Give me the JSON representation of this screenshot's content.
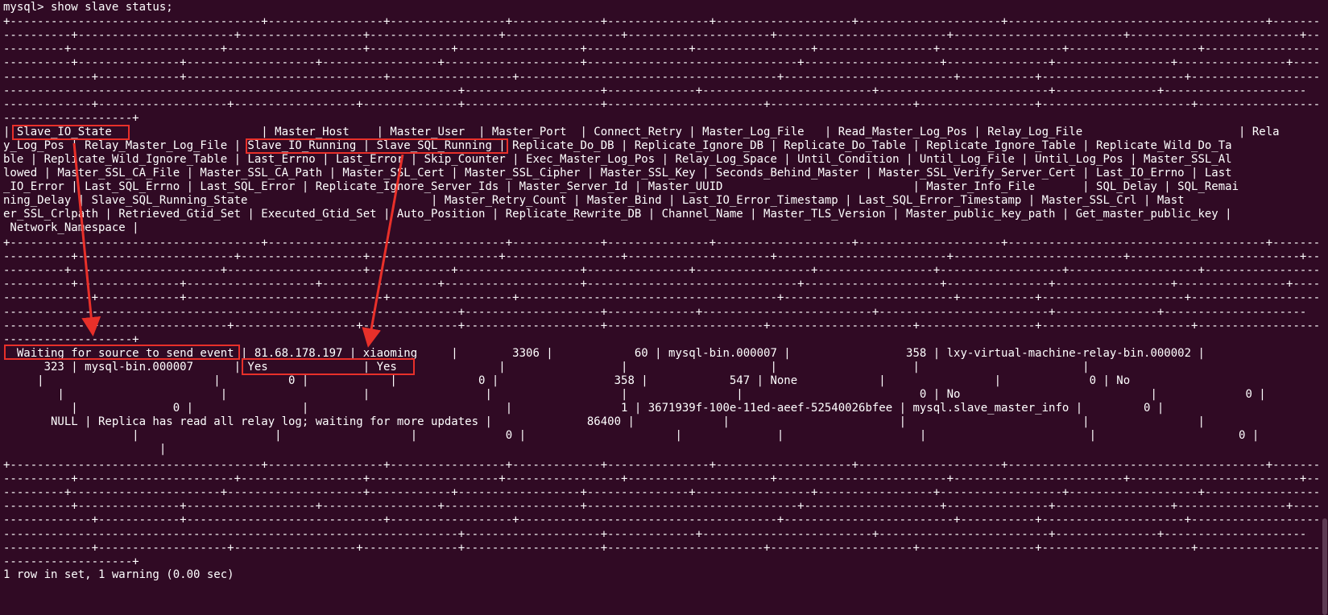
{
  "terminal": {
    "colors": {
      "background": "#300a24",
      "text": "#ffffff",
      "annotation": "#e8302a"
    },
    "lines": [
      "mysql> show slave status;",
      "+-------------------------------------+-----------------+-----------------+-------------+---------------+--------------------+---------------------+--------------------------------------+---------",
      "----------+-----------------------+------------------+-------------------+-----------------+---------------------+-------------------------+-------------------------+-------------------------+---------",
      "---------+----------------------+--------------------+------------+------------------+---------------+-----------------+-----------------+------------------+-------------------+-----------------------",
      "----------+---------------+-------------------+-----------------+--------------------+-------------------------------+--------------------+---------------+-----------------+----------------+---------",
      "-------------+------------+-----------------------------+------------------+--------------------------------------+-------------------------+-----------+---------------------+----------------------",
      "-------------------------------------------------------------------+--------------------+-------------+-------------------------+-------------------------+---------------+---------------------",
      "-------------+-------------------+------------------+--------------+--------------------+-----------------------+---------------------+-----------------+----------------------+-----------------------",
      "-------------------+",
      "| Slave_IO_State                      | Master_Host    | Master_User  | Master_Port  | Connect_Retry | Master_Log_File   | Read_Master_Log_Pos | Relay_Log_File                       | Rela",
      "y_Log_Pos | Relay_Master_Log_File | Slave_IO_Running | Slave_SQL_Running | Replicate_Do_DB | Replicate_Ignore_DB | Replicate_Do_Table | Replicate_Ignore_Table | Replicate_Wild_Do_Ta",
      "ble | Replicate_Wild_Ignore_Table | Last_Errno | Last_Error | Skip_Counter | Exec_Master_Log_Pos | Relay_Log_Space | Until_Condition | Until_Log_File | Until_Log_Pos | Master_SSL_Al",
      "lowed | Master_SSL_CA_File | Master_SSL_CA_Path | Master_SSL_Cert | Master_SSL_Cipher | Master_SSL_Key | Seconds_Behind_Master | Master_SSL_Verify_Server_Cert | Last_IO_Errno | Last",
      "_IO_Error | Last_SQL_Errno | Last_SQL_Error | Replicate_Ignore_Server_Ids | Master_Server_Id | Master_UUID                            | Master_Info_File       | SQL_Delay | SQL_Remai",
      "ning_Delay | Slave_SQL_Running_State                           | Master_Retry_Count | Master_Bind | Last_IO_Error_Timestamp | Last_SQL_Error_Timestamp | Master_SSL_Crl | Mast",
      "er_SSL_Crlpath | Retrieved_Gtid_Set | Executed_Gtid_Set | Auto_Position | Replicate_Rewrite_DB | Channel_Name | Master_TLS_Version | Master_public_key_path | Get_master_public_key |",
      " Network_Namespace |",
      "+-------------------------------------+-----------------+-----------------+-------------+---------------+--------------------+---------------------+--------------------------------------+---------",
      "----------+-----------------------+------------------+-------------------+-----------------+---------------------+-------------------------+-------------------------+-------------------------+---------",
      "---------+----------------------+--------------------+------------+------------------+---------------+-----------------+-----------------+------------------+-------------------+-----------------------",
      "----------+---------------+-------------------+-----------------+--------------------+-------------------------------+--------------------+---------------+-----------------+----------------+---------",
      "-------------+------------+-----------------------------+------------------+--------------------------------------+-------------------------+-----------+---------------------+----------------------",
      "-------------------------------------------------------------------+--------------------+-------------+-------------------------+-------------------------+---------------+---------------------",
      "-------------+-------------------+------------------+--------------+--------------------+-----------------------+---------------------+-----------------+----------------------+-----------------------",
      "-------------------+",
      "  Waiting for source to send event | 81.68.178.197 | xiaoming     |        3306 |            60 | mysql-bin.000007 |                 358 | lxy-virtual-machine-relay-bin.000002 |",
      "      323 | mysql-bin.000007      | Yes              | Yes               |                 |                     |                    |                        |",
      "     |                         |          0 |            |            0 |                 358 |            547 | None            |                |             0 | No",
      "        |                       |                    |                 |                   |                |                          0 | No                            |             0 |",
      "          |              0 |                |                             |                1 | 3671939f-100e-11ed-aeef-52540026bfee | mysql.slave_master_info |         0 |",
      "       NULL | Replica has read all relay log; waiting for more updates |              86400 |             |                         |                          |                |",
      "                   |                    |                   |             0 |                      |              |                    |                        |                     0 |",
      "                       |",
      "+-------------------------------------+-----------------+-----------------+-------------+---------------+--------------------+---------------------+--------------------------------------+---------",
      "----------+-----------------------+------------------+-------------------+-----------------+---------------------+-------------------------+-------------------------+-------------------------+---------",
      "---------+----------------------+--------------------+------------+------------------+---------------+-----------------+-----------------+------------------+-------------------+-----------------------",
      "----------+---------------+-------------------+-----------------+--------------------+-------------------------------+--------------------+---------------+-----------------+----------------+---------",
      "-------------+------------+-----------------------------+------------------+--------------------------------------+-------------------------+-----------+---------------------+----------------------",
      "-------------------------------------------------------------------+--------------------+-------------+-------------------------+-------------------------+---------------+---------------------",
      "-------------+-------------------+------------------+--------------+--------------------+-----------------------+---------------------+-----------------+----------------------+-----------------------",
      "-------------------+",
      "1 row in set, 1 warning (0.00 sec)"
    ]
  }
}
